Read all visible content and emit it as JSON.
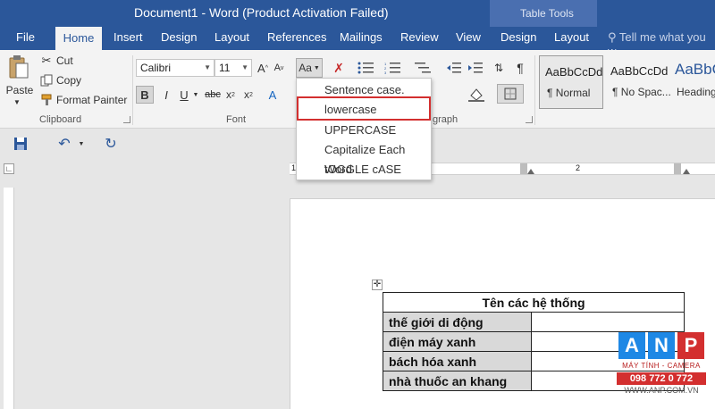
{
  "window": {
    "title": "Document1 - Word (Product Activation Failed)",
    "contextual_group": "Table Tools"
  },
  "tabs": {
    "file": "File",
    "home": "Home",
    "insert": "Insert",
    "design": "Design",
    "layout": "Layout",
    "references": "References",
    "mailings": "Mailings",
    "review": "Review",
    "view": "View",
    "table_design": "Design",
    "table_layout": "Layout",
    "tell_me": "Tell me what you w"
  },
  "clipboard": {
    "paste": "Paste",
    "cut": "Cut",
    "copy": "Copy",
    "format_painter": "Format Painter",
    "group_label": "Clipboard"
  },
  "font": {
    "name": "Calibri",
    "size": "11",
    "change_case": "Aa",
    "group_label": "Font"
  },
  "paragraph": {
    "group_label": "graph"
  },
  "styles": [
    {
      "preview": "AaBbCcDd",
      "name": "¶ Normal"
    },
    {
      "preview": "AaBbCcDd",
      "name": "¶ No Spac..."
    },
    {
      "preview": "AaBbC",
      "name": "Heading"
    }
  ],
  "case_menu": [
    {
      "label": "Sentence case."
    },
    {
      "label": "lowercase"
    },
    {
      "label": "UPPERCASE"
    },
    {
      "label": "Capitalize Each Word"
    },
    {
      "label": "tOGGLE cASE"
    }
  ],
  "ruler": {
    "marks": [
      "1",
      "2"
    ]
  },
  "table": {
    "header": "Tên các hệ thống",
    "rows": [
      "thế giới di động",
      "điện máy xanh",
      "bách hóa xanh",
      "nhà thuốc an khang"
    ]
  },
  "watermark": {
    "letters": [
      "A",
      "N",
      "P"
    ],
    "tagline": "MÁY TÍNH - CAMERA",
    "phone": "098 772 0 772",
    "website": "WWW.ANP.COM.VN"
  },
  "colors": {
    "titlebar": "#2b579a",
    "accent_red": "#d32f2f",
    "ribbon": "#f3f3f3"
  }
}
